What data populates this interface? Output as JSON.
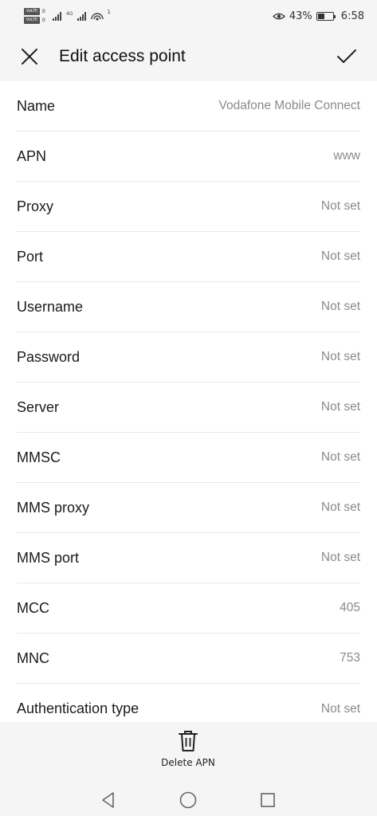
{
  "status_bar": {
    "sim1": "VoLTE",
    "sim1_suffix": "B",
    "sim2": "VoLTE",
    "sim2_suffix": "B",
    "network": "4G",
    "notif_count": "1",
    "battery_percent": "43%",
    "battery_level": 0.43,
    "time": "6:58"
  },
  "app_bar": {
    "title": "Edit access point"
  },
  "fields": [
    {
      "label": "Name",
      "value": "Vodafone Mobile Connect"
    },
    {
      "label": "APN",
      "value": "www"
    },
    {
      "label": "Proxy",
      "value": "Not set"
    },
    {
      "label": "Port",
      "value": "Not set"
    },
    {
      "label": "Username",
      "value": "Not set"
    },
    {
      "label": "Password",
      "value": "Not set"
    },
    {
      "label": "Server",
      "value": "Not set"
    },
    {
      "label": "MMSC",
      "value": "Not set"
    },
    {
      "label": "MMS proxy",
      "value": "Not set"
    },
    {
      "label": "MMS port",
      "value": "Not set"
    },
    {
      "label": "MCC",
      "value": "405"
    },
    {
      "label": "MNC",
      "value": "753"
    },
    {
      "label": "Authentication type",
      "value": "Not set"
    }
  ],
  "bottom": {
    "delete_label": "Delete APN"
  },
  "icons": {
    "close": "close-icon",
    "confirm": "check-icon",
    "delete": "trash-icon",
    "back": "back-triangle-icon",
    "home": "home-circle-icon",
    "recents": "recents-square-icon"
  }
}
